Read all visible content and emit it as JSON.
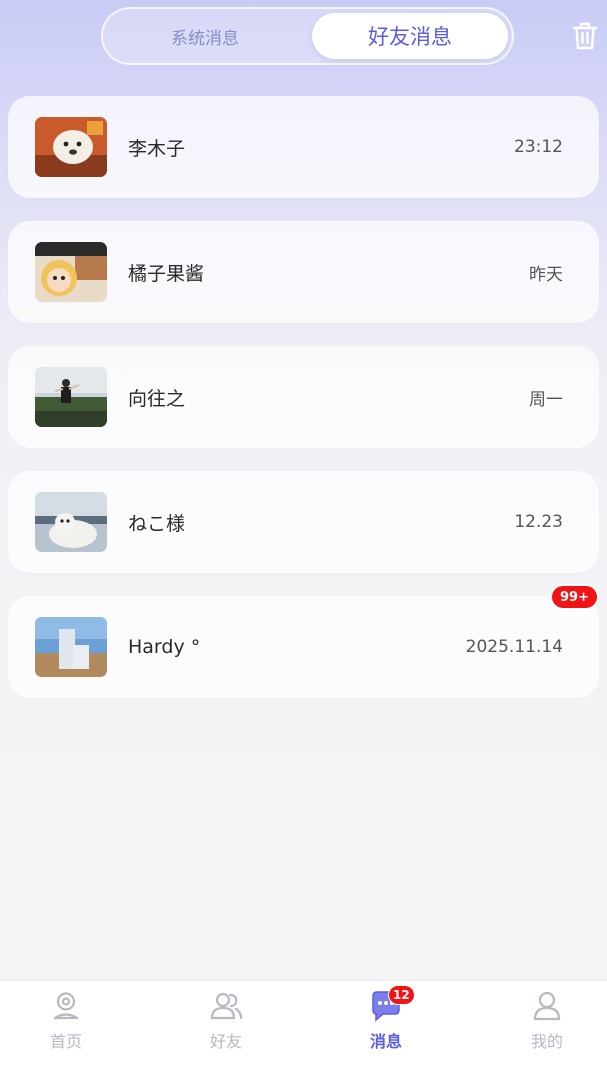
{
  "tabs": {
    "system": "系统消息",
    "friends": "好友消息",
    "active": "friends"
  },
  "header": {
    "delete_icon": "trash-icon"
  },
  "conversations": [
    {
      "name": "李木子",
      "time": "23:12"
    },
    {
      "name": "橘子果酱",
      "time": "昨天"
    },
    {
      "name": "向往之",
      "time": "周一"
    },
    {
      "name": "ねこ様",
      "time": "12.23"
    },
    {
      "name": "Hardy °",
      "time": "2025.11.14",
      "unread_badge": "99+"
    }
  ],
  "nav": {
    "items": [
      {
        "label": "首页",
        "icon": "home-icon"
      },
      {
        "label": "好友",
        "icon": "friends-icon"
      },
      {
        "label": "消息",
        "icon": "chat-icon",
        "badge": "12"
      },
      {
        "label": "我的",
        "icon": "profile-icon"
      }
    ],
    "active_index": 2
  },
  "colors": {
    "accent": "#5b5ee0",
    "badge": "#f01414",
    "inactive": "#b8b8c4"
  }
}
